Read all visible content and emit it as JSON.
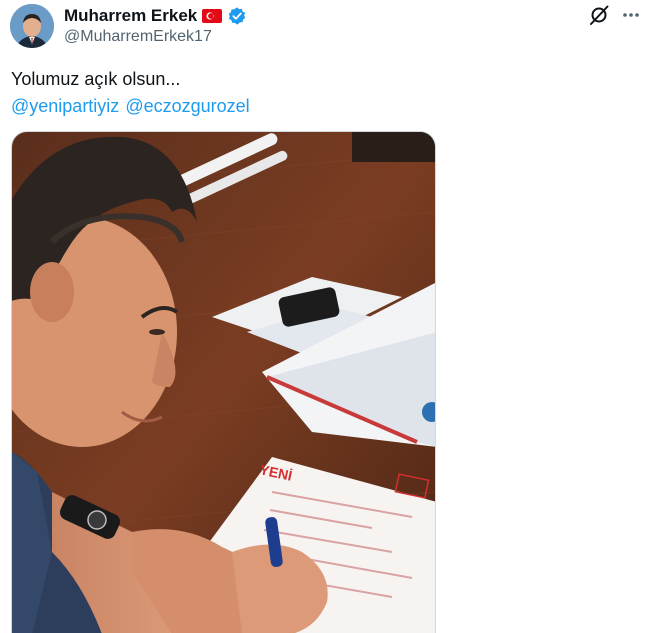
{
  "author": {
    "display_name": "Muharrem Erkek",
    "handle": "@MuharremErkek17",
    "flag": "turkey-flag",
    "verified": true
  },
  "tweet": {
    "text": "Yolumuz açık olsun...",
    "mentions": [
      "@yenipartiyiz",
      "@eczozgurozel"
    ]
  },
  "media": {
    "form_brand": "YENİ"
  },
  "colors": {
    "link": "#1d9bf0",
    "verified": "#1d9bf0",
    "secondary_text": "#536471"
  }
}
